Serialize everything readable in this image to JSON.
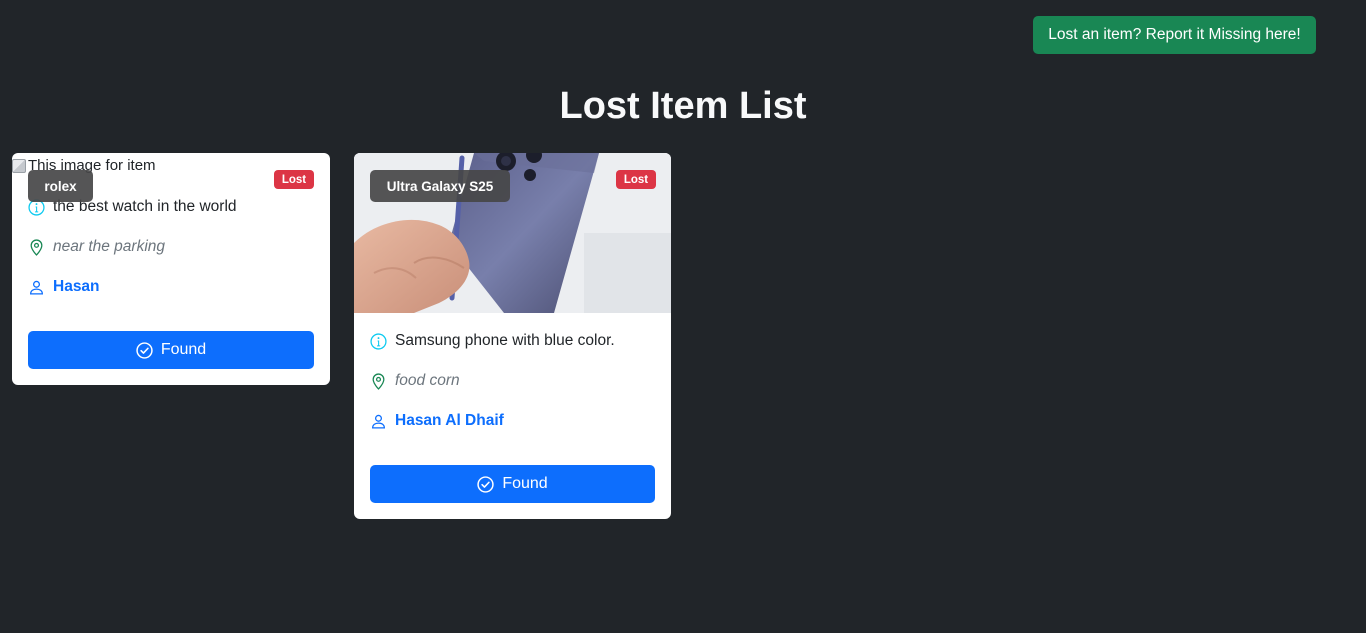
{
  "header": {
    "report_button": "Lost an item? Report it Missing here!",
    "title": "Lost Item List"
  },
  "colors": {
    "background": "#212529",
    "report_button": "#198754",
    "status_lost": "#dc3545",
    "found_button": "#0d6efd",
    "owner_link": "#0d6efd",
    "info_icon": "#0dcaf0",
    "location_icon": "#198754"
  },
  "items": [
    {
      "image_alt": "This image for item",
      "name": "rolex",
      "status": "Lost",
      "description": "the best watch in the world",
      "location": "near the parking",
      "owner": "Hasan",
      "found_label": "Found"
    },
    {
      "name": "Ultra Galaxy S25",
      "status": "Lost",
      "description": "Samsung phone with blue color.",
      "location": "food corn",
      "owner": "Hasan Al Dhaif",
      "found_label": "Found"
    }
  ]
}
